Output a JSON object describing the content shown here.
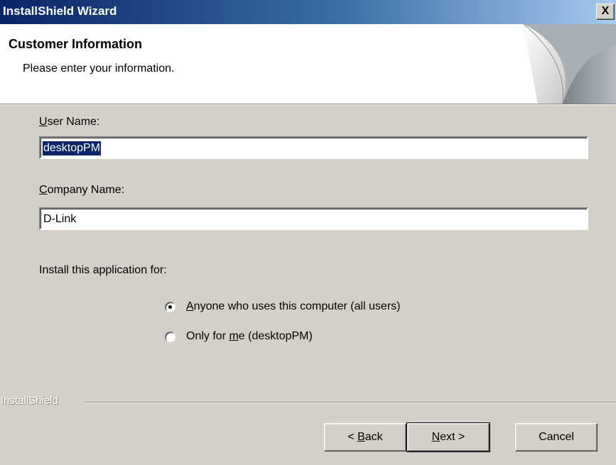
{
  "window": {
    "title": "InstallShield Wizard",
    "close_glyph": "X"
  },
  "header": {
    "title": "Customer Information",
    "subtitle": "Please enter your information."
  },
  "form": {
    "user_name_label_hotkey": "U",
    "user_name_label_rest": "ser Name:",
    "user_name_value": "desktopPM",
    "company_label_hotkey": "C",
    "company_label_rest": "ompany Name:",
    "company_value": "D-Link",
    "install_for_label": "Install this application for:"
  },
  "radios": {
    "all_users_hotkey": "A",
    "all_users_rest": "nyone who uses this computer (all users)",
    "only_me_pre": "Only for ",
    "only_me_hotkey": "m",
    "only_me_post": "e (desktopPM)",
    "selected": "all_users"
  },
  "footer": {
    "brand": "InstallShield"
  },
  "buttons": {
    "back_pre": "< ",
    "back_hotkey": "B",
    "back_rest": "ack",
    "next_hotkey": "N",
    "next_rest": "ext >",
    "cancel": "Cancel"
  },
  "colors": {
    "titlebar_start": "#0a246a",
    "titlebar_end": "#a6caf0",
    "dialog_bg": "#d4d0c8",
    "selection_bg": "#0a246a"
  },
  "icons": {
    "header_art": "page-curl-icon",
    "close": "close-icon"
  }
}
